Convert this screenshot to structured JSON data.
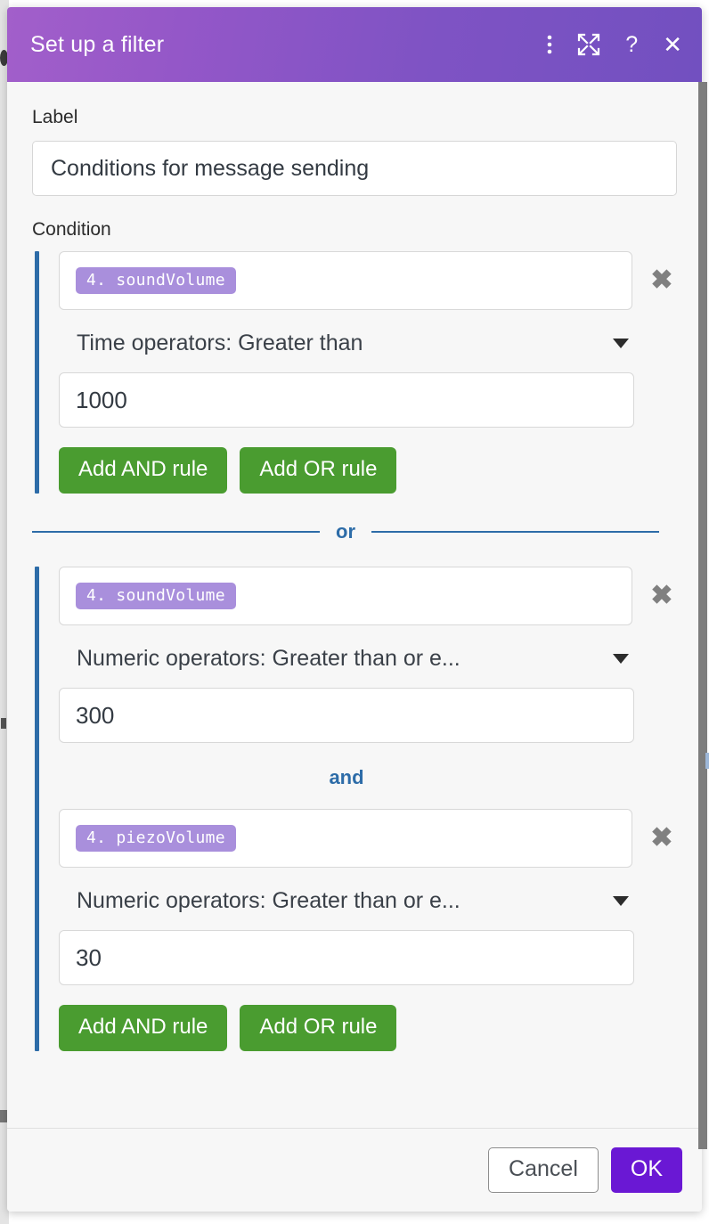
{
  "window": {
    "title": "Set up a filter",
    "actions": [
      {
        "name": "more-options-icon",
        "glyph": "⋮"
      },
      {
        "name": "expand-icon",
        "glyph": "⤢"
      },
      {
        "name": "help-icon",
        "glyph": "?"
      },
      {
        "name": "close-icon",
        "glyph": "✕"
      }
    ]
  },
  "form": {
    "label_caption": "Label",
    "label_value": "Conditions for message sending",
    "label_placeholder": "",
    "condition_caption": "Condition"
  },
  "groups": [
    {
      "rules": [
        {
          "variable": "4. soundVolume",
          "operator": "Time operators: Greater than",
          "value": "1000",
          "delete_glyph": "✖"
        }
      ],
      "connector_after_rule": "",
      "add_and_label": "Add AND rule",
      "add_or_label": "Add OR rule"
    },
    {
      "rules": [
        {
          "variable": "4. soundVolume",
          "operator": "Numeric operators: Greater than or e...",
          "value": "300",
          "delete_glyph": "✖"
        },
        {
          "variable": "4. piezoVolume",
          "operator": "Numeric operators: Greater than or e...",
          "value": "30",
          "delete_glyph": "✖"
        }
      ],
      "connector_after_rule": "and",
      "add_and_label": "Add AND rule",
      "add_or_label": "Add OR rule"
    }
  ],
  "divider": {
    "or_label": "or"
  },
  "footer": {
    "cancel_label": "Cancel",
    "ok_label": "OK"
  },
  "colors": {
    "title_gradient_start": "#a25fca",
    "title_gradient_end": "#7250c0",
    "group_accent": "#2d6ca8",
    "chip_bg": "#a98fdc",
    "green_button": "#4a9c30",
    "ok_button": "#6a18d4",
    "connector_text": "#2d6ca8",
    "dialog_bg": "#f7f7f7"
  }
}
